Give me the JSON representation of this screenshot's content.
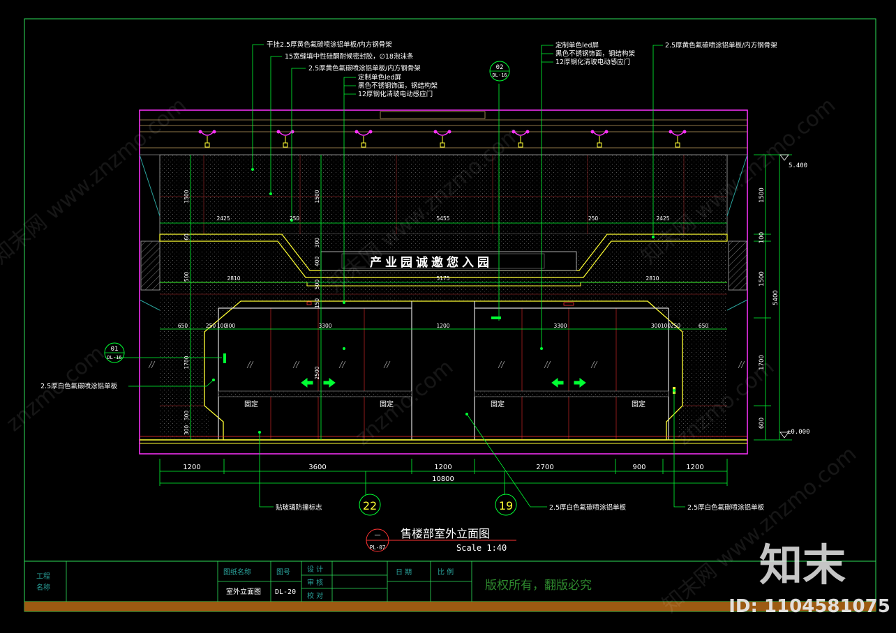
{
  "annotations_left": [
    "干挂2.5厚黄色氟碳喷涂铝单板/内方钢骨架",
    "15宽缝填中性硅酮耐候密封胶，∅18泡沫条",
    "2.5厚黄色氟碳喷涂铝单板/内方钢骨架",
    "定制单色led屏",
    "黑色不锈钢饰面，钢结构架",
    "12厚钢化清玻电动感应门"
  ],
  "annotations_right": [
    "定制单色led屏",
    "黑色不锈钢饰面，钢结构架",
    "12厚钢化清玻电动感应门"
  ],
  "annotation_right_top": "2.5厚黄色氟碳喷涂铝单板/内方钢骨架",
  "annotation_side_left": "2.5厚白色氟碳喷涂铝单板",
  "annotation_bottom_1": "贴玻璃防撞标志",
  "annotation_bottom_2": "2.5厚白色氟碳喷涂铝单板",
  "annotation_bottom_3": "2.5厚白色氟碳喷涂铝单板",
  "sign_text": "产业园诚邀您入园",
  "glass_label": "固定",
  "callout_top": {
    "num": "02",
    "ref": "DL-16"
  },
  "callout_left": {
    "num": "01",
    "ref": "DL-16"
  },
  "grid_axes": [
    "22",
    "19"
  ],
  "dims_bottom": [
    "1200",
    "3600",
    "1200",
    "2700",
    "900",
    "1200"
  ],
  "dim_total": "10800",
  "dims_upper_left": [
    "2425",
    "250"
  ],
  "dims_upper_mid": "5455",
  "dims_upper_right": [
    "250",
    "2425"
  ],
  "dims_mid_row": [
    "2810",
    "5175",
    "2810"
  ],
  "dims_door_row_left": [
    "650",
    "250",
    "100",
    "300"
  ],
  "dims_door_row_mid": [
    "3300",
    "1200",
    "3300"
  ],
  "dims_door_row_right": [
    "300",
    "100",
    "250",
    "650"
  ],
  "dims_vertical_left": [
    "1500",
    "60",
    "500",
    "1700",
    "300",
    "300"
  ],
  "dims_vertical_inner": [
    "1500",
    "300",
    "400",
    "500",
    "150",
    "2500"
  ],
  "dims_right": [
    "1500",
    "100",
    "1500",
    "1700",
    "600"
  ],
  "dim_right_total": "5400",
  "elev_top": "5.400",
  "elev_bottom": "±0.000",
  "title": {
    "symbol_num": "一",
    "symbol_ref": "PL-07",
    "name": "售楼部室外立面图",
    "scale": "Scale 1:40"
  },
  "titleblock": {
    "project_label": "工程\n名称",
    "drawing_name_label": "图纸名称",
    "drawing_name_value": "室外立面图",
    "drawing_no_label": "图号",
    "drawing_no_value": "DL-20",
    "design": "设 计",
    "review": "审 核",
    "check": "校 对",
    "date": "日 期",
    "ratio": "比 例",
    "copyright": "版权所有，翻版必究"
  },
  "watermark_logo": "知末",
  "watermark_id": "ID: 1104581075",
  "watermark_repeat": "znzmo.com",
  "watermark_cn": "知末网 www.znzmo.com",
  "colors": {
    "bg": "#000000",
    "magenta": "#ff33ff",
    "green": "#00ff33",
    "white": "#ffffff",
    "yellow": "#ffff33",
    "red": "#ff3333",
    "darkred": "#8b1a1a",
    "grey": "#8a8a8a",
    "teal": "#2aa39c",
    "brown": "#9c5a12"
  }
}
